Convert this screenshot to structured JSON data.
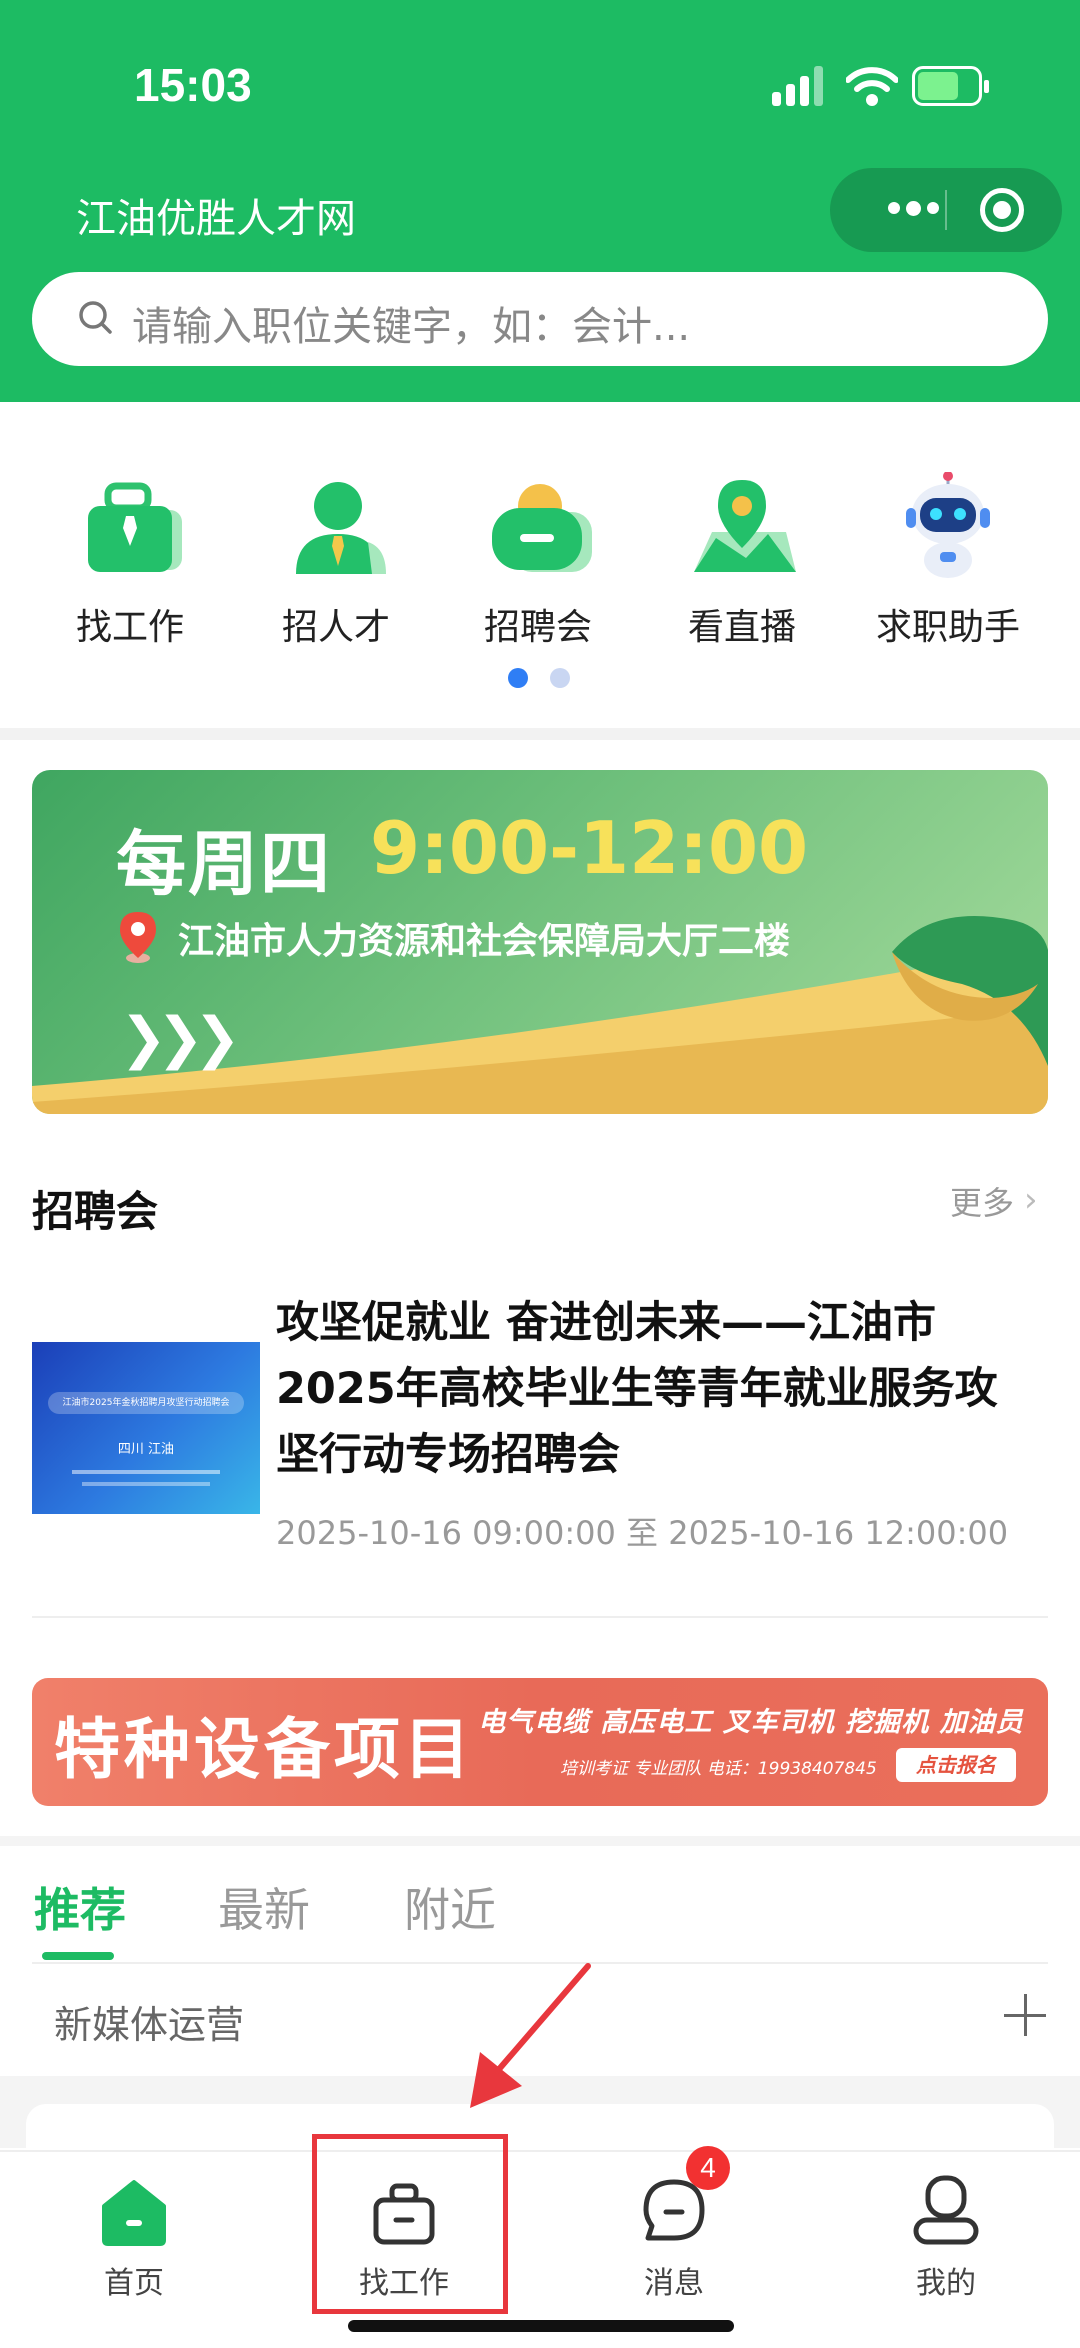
{
  "status_bar": {
    "time": "15:03"
  },
  "app": {
    "title": "江油优胜人才网"
  },
  "search": {
    "placeholder": "请输入职位关键字，如：会计..."
  },
  "quick_menu": [
    {
      "label": "找工作",
      "icon": "briefcase-icon"
    },
    {
      "label": "招人才",
      "icon": "recruiter-person-icon"
    },
    {
      "label": "招聘会",
      "icon": "job-fair-icon"
    },
    {
      "label": "看直播",
      "icon": "live-map-pin-icon"
    },
    {
      "label": "求职助手",
      "icon": "robot-assistant-icon"
    }
  ],
  "quick_menu_page": {
    "current": 1,
    "total": 2
  },
  "banner_fair": {
    "day": "每周四",
    "time": "9:00-12:00",
    "address": "江油市人力资源和社会保障局大厅二楼",
    "arrows": "❯❯❯"
  },
  "fair_section": {
    "title": "招聘会",
    "more": "更多",
    "item": {
      "title": "攻坚促就业 奋进创未来——江油市2025年高校毕业生等青年就业服务攻坚行动专场招聘会",
      "date_range": "2025-10-16 09:00:00 至 2025-10-16 12:00:00",
      "thumb_heading": "江油市2025年金秋招聘月攻坚行动招聘会",
      "thumb_city": "四川 江油"
    }
  },
  "banner_ad": {
    "headline": "特种设备项目",
    "tags": "电气电缆 高压电工 叉车司机 挖掘机 加油员",
    "sub": "培训考证  专业团队  电话：19938407845",
    "cta": "点击报名"
  },
  "job_tabs": [
    {
      "label": "推荐",
      "active": true
    },
    {
      "label": "最新",
      "active": false
    },
    {
      "label": "附近",
      "active": false
    }
  ],
  "job_filter": {
    "keyword": "新媒体运营"
  },
  "bottom_nav": [
    {
      "label": "首页",
      "icon": "home-icon",
      "active": true
    },
    {
      "label": "找工作",
      "icon": "briefcase-icon",
      "active": false
    },
    {
      "label": "消息",
      "icon": "message-icon",
      "active": false,
      "badge": "4"
    },
    {
      "label": "我的",
      "icon": "profile-icon",
      "active": false
    }
  ],
  "colors": {
    "brand": "#1dbb63",
    "annotation": "#e8373d",
    "badge": "#f23131"
  }
}
